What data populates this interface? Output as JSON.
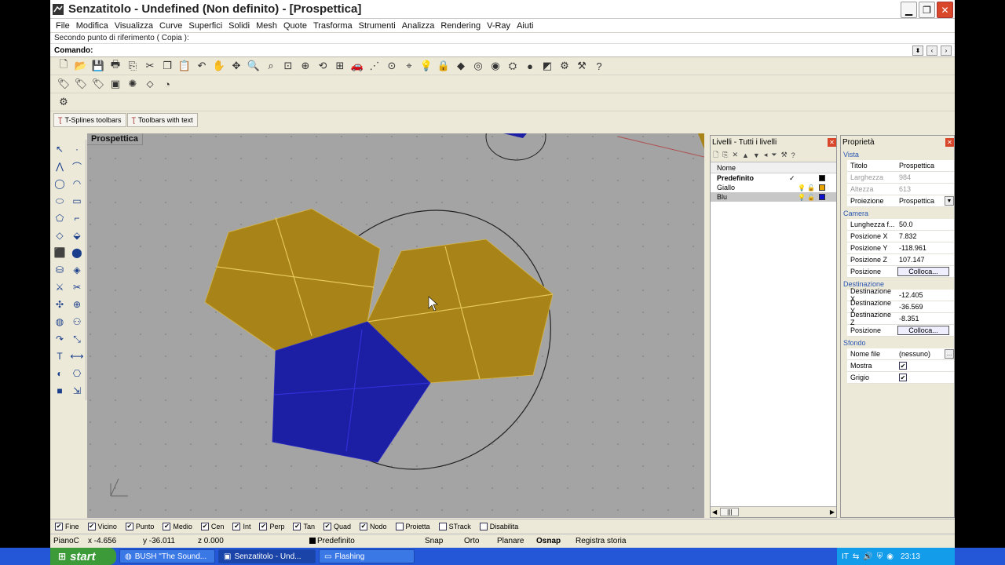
{
  "window": {
    "title": "Senzatitolo - Undefined (Non definito) - [Prospettica]",
    "minimize": "▁",
    "restore": "❐",
    "close": "✕"
  },
  "menu": [
    "File",
    "Modifica",
    "Visualizza",
    "Curve",
    "Superfici",
    "Solidi",
    "Mesh",
    "Quote",
    "Trasforma",
    "Strumenti",
    "Analizza",
    "Rendering",
    "V-Ray",
    "Aiuti"
  ],
  "command": {
    "history": "Secondo punto di riferimento ( Copia ):",
    "label": "Comando:",
    "value": ""
  },
  "toolbar_tabs": [
    "T-Splines toolbars",
    "Toolbars with text"
  ],
  "viewport": {
    "label": "Prospettica"
  },
  "layers": {
    "title": "Livelli - Tutti i livelli",
    "column_name": "Nome",
    "rows": [
      {
        "name": "Predefinito",
        "current": "✓",
        "color": "#000000"
      },
      {
        "name": "Giallo",
        "current": "",
        "color": "#e8a300"
      },
      {
        "name": "Blu",
        "current": "",
        "color": "#1010cc"
      }
    ]
  },
  "properties": {
    "title": "Proprietà",
    "vista_section": "Vista",
    "titolo_label": "Titolo",
    "titolo_value": "Prospettica",
    "larghezza_label": "Larghezza",
    "larghezza_value": "984",
    "altezza_label": "Altezza",
    "altezza_value": "613",
    "proiezione_label": "Proiezione",
    "proiezione_value": "Prospettica",
    "camera_section": "Camera",
    "lunghezza_label": "Lunghezza f...",
    "lunghezza_value": "50.0",
    "posx_label": "Posizione X",
    "posx_value": "7.832",
    "posy_label": "Posizione Y",
    "posy_value": "-118.961",
    "posz_label": "Posizione Z",
    "posz_value": "107.147",
    "posizione_label": "Posizione",
    "colloca_label": "Colloca...",
    "destinazione_section": "Destinazione",
    "destx_label": "Destinazione X",
    "destx_value": "-12.405",
    "desty_label": "Destinazione Y",
    "desty_value": "-36.569",
    "destz_label": "Destinazione Z",
    "destz_value": "-8.351",
    "posizione2_label": "Posizione",
    "colloca2_label": "Colloca...",
    "sfondo_section": "Sfondo",
    "nomefile_label": "Nome file",
    "nomefile_value": "(nessuno)",
    "mostra_label": "Mostra",
    "grigio_label": "Grigio"
  },
  "osnap": [
    {
      "label": "Fine",
      "checked": true
    },
    {
      "label": "Vicino",
      "checked": true
    },
    {
      "label": "Punto",
      "checked": true
    },
    {
      "label": "Medio",
      "checked": true
    },
    {
      "label": "Cen",
      "checked": true
    },
    {
      "label": "Int",
      "checked": true
    },
    {
      "label": "Perp",
      "checked": true
    },
    {
      "label": "Tan",
      "checked": true
    },
    {
      "label": "Quad",
      "checked": true
    },
    {
      "label": "Nodo",
      "checked": true
    },
    {
      "label": "Proietta",
      "checked": false
    },
    {
      "label": "STrack",
      "checked": false
    },
    {
      "label": "Disabilita",
      "checked": false
    }
  ],
  "status": {
    "plane": "PianoC",
    "x": "x -4.656",
    "y": "y -36.011",
    "z": "z 0.000",
    "layer": "Predefinito",
    "snap": "Snap",
    "orto": "Orto",
    "planare": "Planare",
    "osnap": "Osnap",
    "storia": "Registra storia"
  },
  "taskbar": {
    "start": "start",
    "tasks": [
      "BUSH \"The Sound...",
      "Senzatitolo - Und...",
      "Flashing"
    ],
    "lang": "IT",
    "clock": "23:13"
  },
  "colors": {
    "yellow_surface": "#a88318",
    "blue_surface": "#1c1ea3",
    "viewport_bg": "#a4a4a4"
  }
}
